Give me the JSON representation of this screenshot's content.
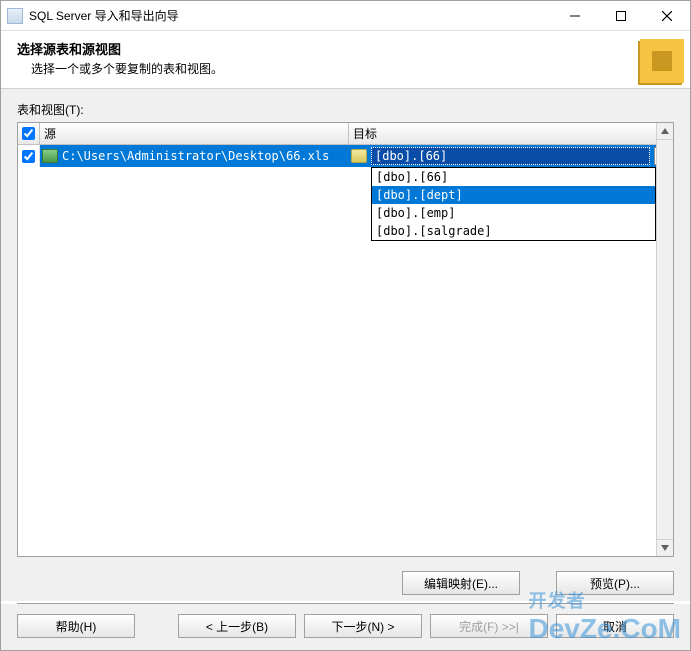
{
  "window": {
    "title": "SQL Server 导入和导出向导"
  },
  "header": {
    "title": "选择源表和源视图",
    "description": "选择一个或多个要复制的表和视图。"
  },
  "listLabel": "表和视图(T):",
  "columns": {
    "source": "源",
    "destination": "目标"
  },
  "rows": [
    {
      "checked": true,
      "source": "C:\\Users\\Administrator\\Desktop\\66.xls",
      "destination": "[dbo].[66]"
    }
  ],
  "dropdown": {
    "items": [
      "[dbo].[66]",
      "[dbo].[dept]",
      "[dbo].[emp]",
      "[dbo].[salgrade]"
    ],
    "selectedIndex": 1
  },
  "buttons": {
    "editMapping": "编辑映射(E)...",
    "preview": "预览(P)...",
    "help": "帮助(H)",
    "back": "< 上一步(B)",
    "next": "下一步(N) >",
    "finish": "完成(F) >>|",
    "cancel": "取消"
  },
  "watermark": {
    "line1": "开发者",
    "line2": "DevZe.CoM"
  }
}
